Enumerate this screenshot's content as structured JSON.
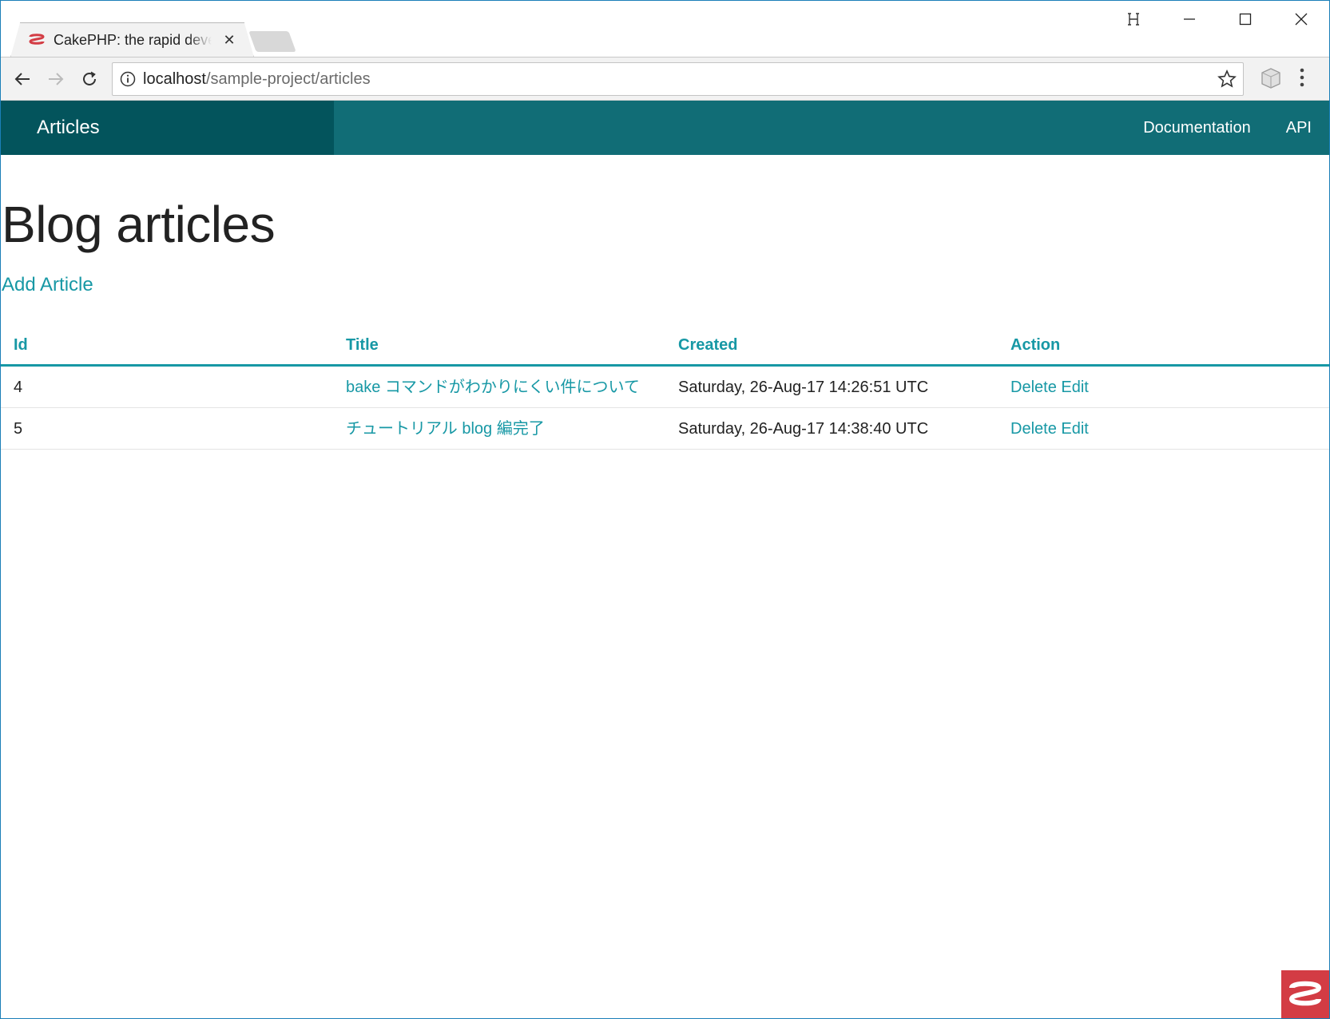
{
  "browser": {
    "tab_title": "CakePHP: the rapid development php framework",
    "url_host": "localhost",
    "url_path": "/sample-project/articles"
  },
  "topbar": {
    "title": "Articles",
    "links": [
      "Documentation",
      "API"
    ]
  },
  "page": {
    "heading": "Blog articles",
    "add_link": "Add Article"
  },
  "table": {
    "headers": [
      "Id",
      "Title",
      "Created",
      "Action"
    ],
    "rows": [
      {
        "id": "4",
        "title": "bake コマンドがわかりにくい件について",
        "created": "Saturday, 26-Aug-17 14:26:51 UTC",
        "delete": "Delete",
        "edit": "Edit"
      },
      {
        "id": "5",
        "title": "チュートリアル blog 編完了",
        "created": "Saturday, 26-Aug-17 14:38:40 UTC",
        "delete": "Delete",
        "edit": "Edit"
      }
    ]
  },
  "colors": {
    "topbar": "#116d76",
    "topbar_title_bg": "#03545c",
    "link": "#1798a5",
    "cake_red": "#d33c44"
  }
}
